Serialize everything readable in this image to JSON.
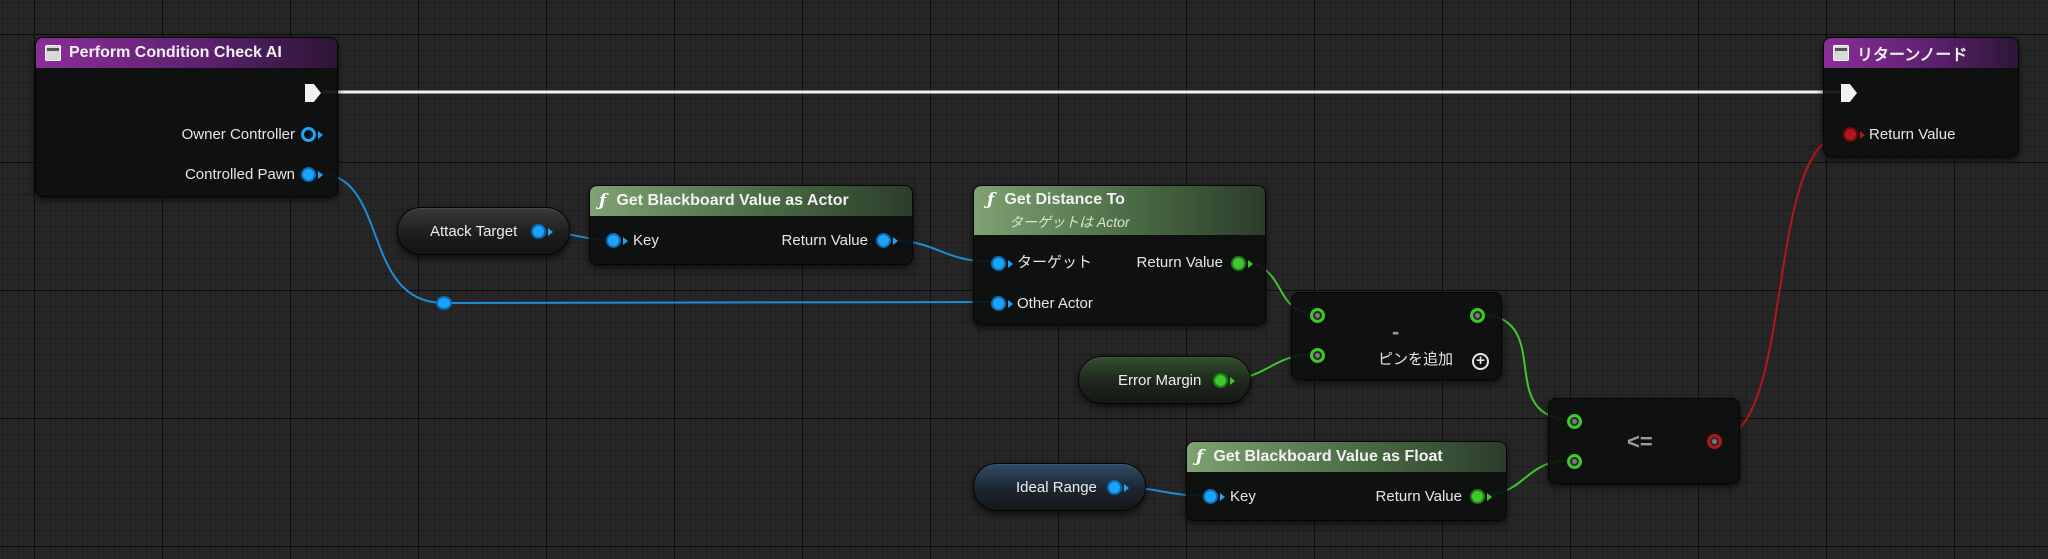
{
  "colors": {
    "background": "#262626",
    "object_wire": "#1a8fd6",
    "float_wire": "#3ec82c",
    "bool_wire": "#b3161a",
    "exec_wire": "#f2f2f2",
    "header_purple": "#8a2e98",
    "header_green": "#7fa173"
  },
  "nodes": {
    "entry": {
      "title": "Perform Condition Check AI",
      "icon": "event-icon",
      "pins": {
        "owner_controller": "Owner Controller",
        "controlled_pawn": "Controlled Pawn"
      }
    },
    "return": {
      "title": "リターンノード",
      "icon": "event-icon",
      "pins": {
        "return_value": "Return Value"
      }
    },
    "get_bb_actor": {
      "title": "Get Blackboard Value as Actor",
      "icon": "function-icon",
      "pins": {
        "key": "Key",
        "return_value": "Return Value"
      }
    },
    "get_distance": {
      "title": "Get Distance To",
      "subtitle_prefix": "ターゲットは",
      "subtitle_target": "Actor",
      "icon": "function-icon",
      "pins": {
        "target": "ターゲット",
        "other_actor": "Other Actor",
        "return_value": "Return Value"
      }
    },
    "subtract": {
      "operator": "-",
      "add_pin_label": "ピンを追加"
    },
    "compare": {
      "operator": "<="
    },
    "get_bb_float": {
      "title": "Get Blackboard Value as Float",
      "icon": "function-icon",
      "pins": {
        "key": "Key",
        "return_value": "Return Value"
      }
    }
  },
  "variables": {
    "attack_target": "Attack Target",
    "error_margin": "Error Margin",
    "ideal_range": "Ideal Range"
  }
}
